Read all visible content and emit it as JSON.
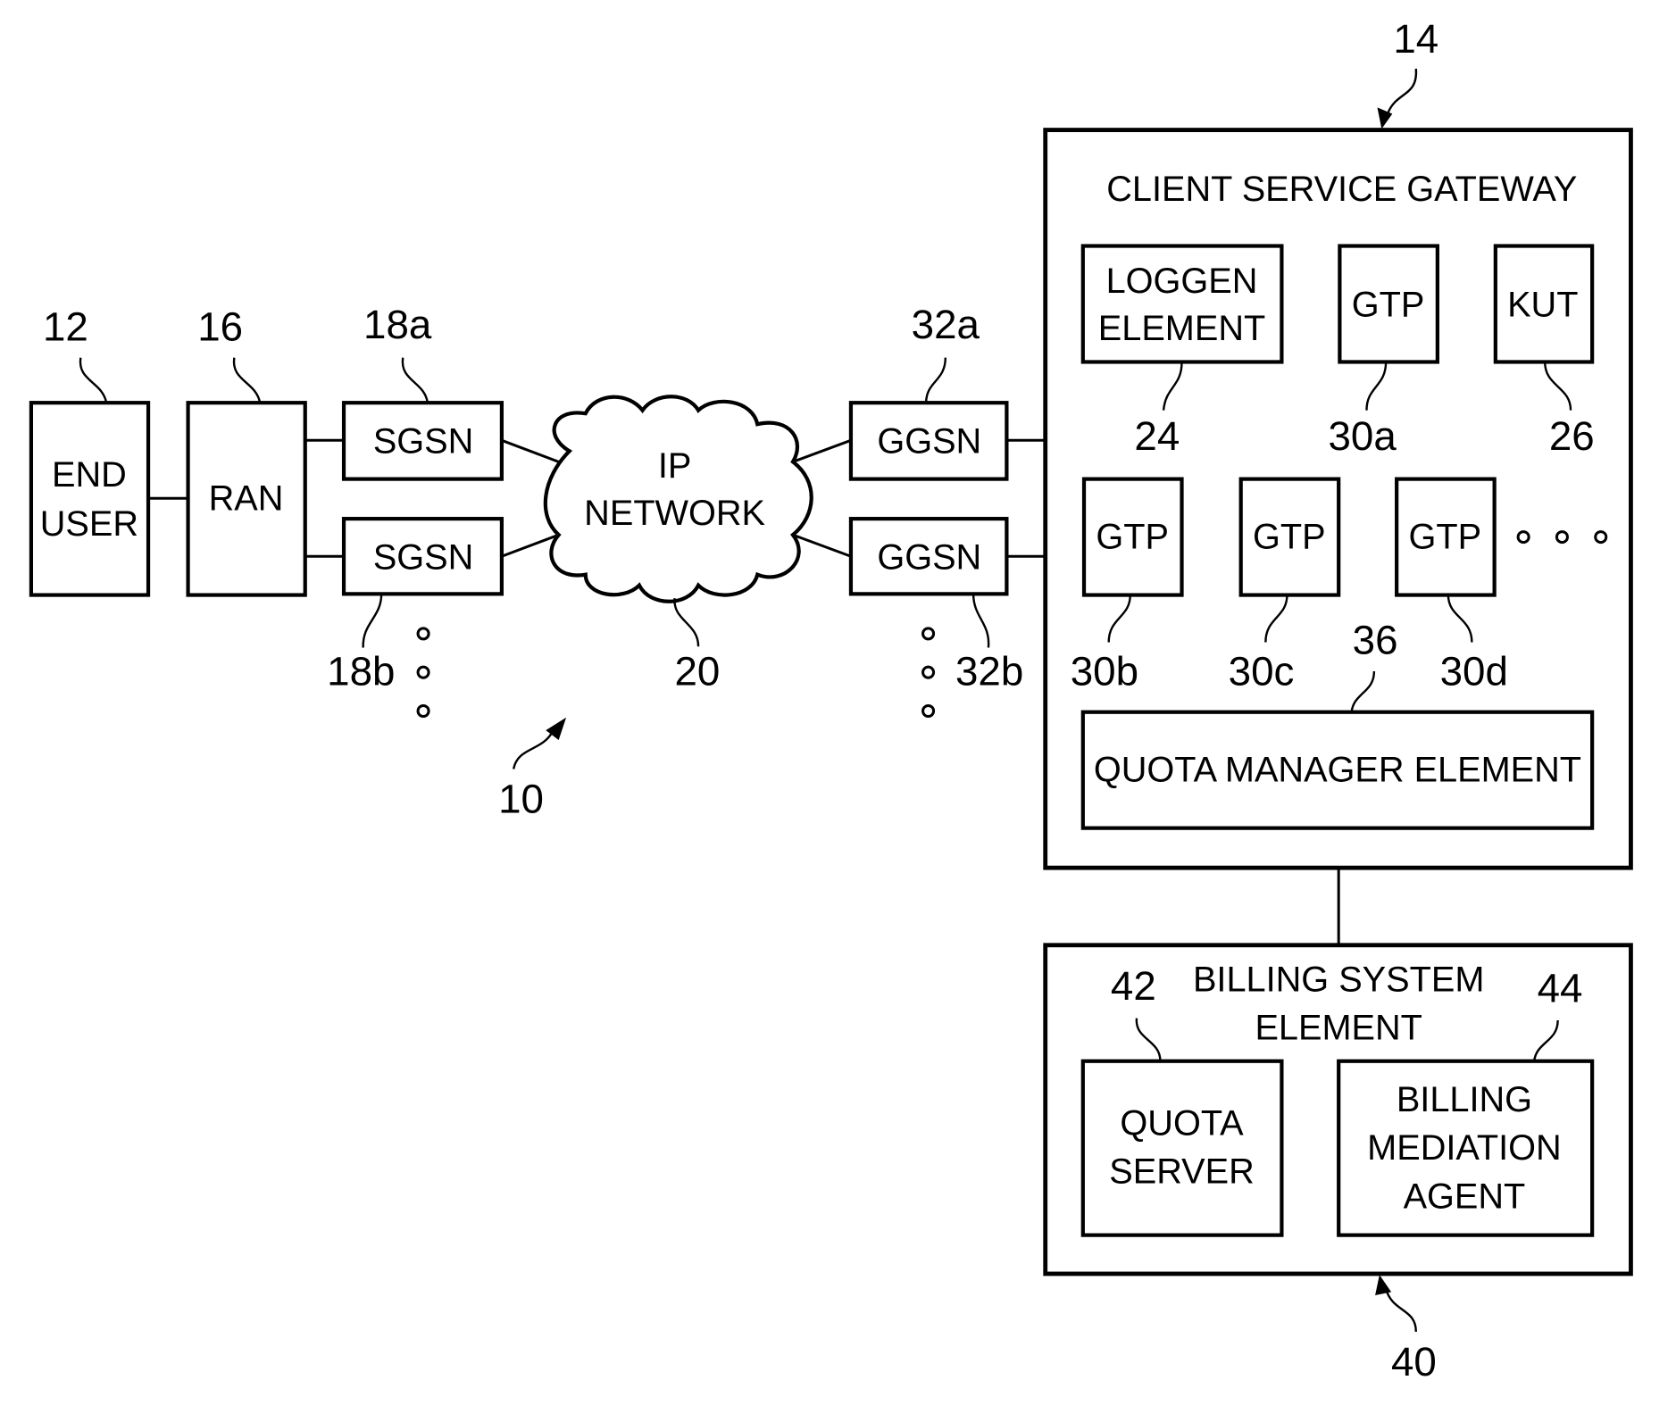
{
  "diagram": {
    "system_ref": "10",
    "nodes": {
      "end_user": {
        "label_line1": "END",
        "label_line2": "USER",
        "ref": "12"
      },
      "ran": {
        "label": "RAN",
        "ref": "16"
      },
      "sgsn_a": {
        "label": "SGSN",
        "ref": "18a"
      },
      "sgsn_b": {
        "label": "SGSN",
        "ref": "18b"
      },
      "ip_network": {
        "label_line1": "IP",
        "label_line2": "NETWORK",
        "ref": "20"
      },
      "ggsn_a": {
        "label": "GGSN",
        "ref": "32a"
      },
      "ggsn_b": {
        "label": "GGSN",
        "ref": "32b"
      },
      "client_service_gateway": {
        "title": "CLIENT SERVICE GATEWAY",
        "ref": "14",
        "loggen": {
          "label_line1": "LOGGEN",
          "label_line2": "ELEMENT",
          "ref": "24"
        },
        "gtp_a": {
          "label": "GTP",
          "ref": "30a"
        },
        "kut": {
          "label": "KUT",
          "ref": "26"
        },
        "gtp_b": {
          "label": "GTP",
          "ref": "30b"
        },
        "gtp_c": {
          "label": "GTP",
          "ref": "30c"
        },
        "gtp_d": {
          "label": "GTP",
          "ref": "30d"
        },
        "quota_manager": {
          "label": "QUOTA MANAGER ELEMENT",
          "ref": "36"
        }
      },
      "billing_system": {
        "title_line1": "BILLING SYSTEM",
        "title_line2": "ELEMENT",
        "ref": "40",
        "quota_server": {
          "label_line1": "QUOTA",
          "label_line2": "SERVER",
          "ref": "42"
        },
        "billing_mediation": {
          "label_line1": "BILLING",
          "label_line2": "MEDIATION",
          "label_line3": "AGENT",
          "ref": "44"
        }
      }
    },
    "colors": {
      "stroke": "#000000",
      "background": "#ffffff"
    }
  }
}
